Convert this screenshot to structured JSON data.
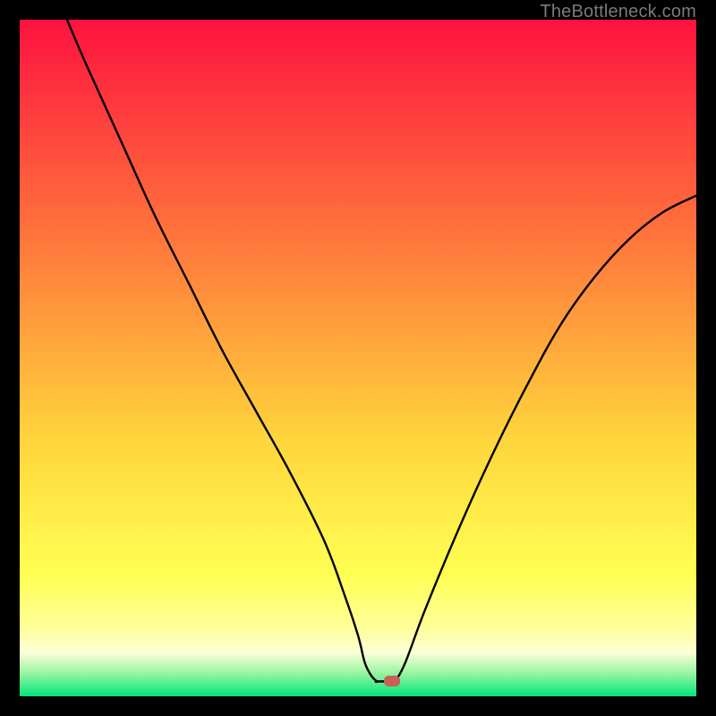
{
  "watermark": "TheBottleneck.com",
  "colors": {
    "frame": "#000000",
    "gradient_top": "#fe123f",
    "gradient_mid1": "#ff6e3c",
    "gradient_mid2": "#ffd53c",
    "gradient_low": "#ffff9b",
    "gradient_pale": "#fdffd8",
    "gradient_green": "#00e77c",
    "curve": "#000000",
    "marker": "#c76057"
  },
  "chart_data": {
    "type": "line",
    "title": "",
    "xlabel": "",
    "ylabel": "",
    "xlim": [
      0,
      100
    ],
    "ylim": [
      0,
      100
    ],
    "series": [
      {
        "name": "bottleneck-curve-left",
        "x": [
          7,
          10,
          15,
          20,
          25,
          30,
          35,
          40,
          45,
          48,
          50,
          51,
          52,
          52.8
        ],
        "values": [
          100,
          93,
          82,
          71,
          61,
          51,
          42,
          33,
          23,
          15,
          9,
          5,
          3,
          2.2
        ]
      },
      {
        "name": "bottleneck-curve-flat",
        "x": [
          52.8,
          55.5
        ],
        "values": [
          2.2,
          2.2
        ]
      },
      {
        "name": "bottleneck-curve-right",
        "x": [
          55.5,
          57,
          60,
          65,
          70,
          75,
          80,
          85,
          90,
          95,
          100
        ],
        "values": [
          2.2,
          5,
          13,
          25,
          36,
          46,
          55,
          62,
          67.5,
          71.5,
          74
        ]
      }
    ],
    "marker": {
      "x": 55,
      "y": 2.2
    },
    "gradient_stops_pct": [
      0,
      30,
      62,
      82,
      90,
      93.5,
      96.5,
      100
    ],
    "gradient_colors": [
      "#fe123f",
      "#ff6e3c",
      "#ffd53c",
      "#ffff53",
      "#ffff9b",
      "#fdffd8",
      "#9cf5a3",
      "#00e77c"
    ]
  }
}
